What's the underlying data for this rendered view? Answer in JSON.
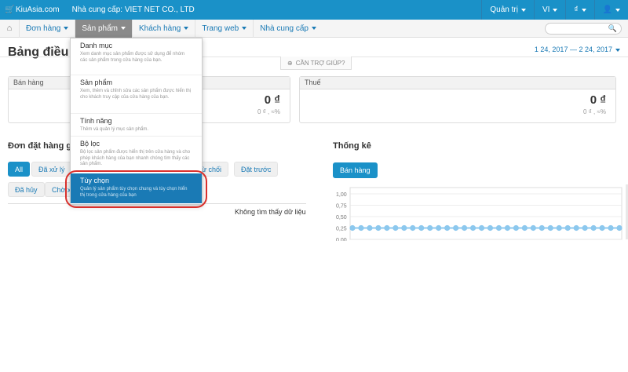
{
  "topbar": {
    "brand": "KiuAsia.com",
    "vendor": "Nhà cung cấp: VIET NET CO., LTD",
    "admin": "Quản trị",
    "lang": "VI",
    "currency": "₫"
  },
  "nav": {
    "items": [
      {
        "label": "Đơn hàng"
      },
      {
        "label": "Sản phẩm"
      },
      {
        "label": "Khách hàng"
      },
      {
        "label": "Trang web"
      },
      {
        "label": "Nhà cung cấp"
      }
    ]
  },
  "page": {
    "title": "Bảng điều k",
    "date_range": "1 24, 2017 — 2 24, 2017",
    "help": "CẦN TRỢ GIÚP?"
  },
  "panels": {
    "sales": {
      "label": "Bán hàng"
    },
    "sales_partial": {
      "amount": "0 ₫",
      "sub": "0 ₫ , ≈%"
    },
    "tax": {
      "label": "Thuế",
      "amount": "0 ₫",
      "sub": "0 ₫ , ≈%"
    }
  },
  "orders": {
    "title": "Đơn đặt hàng gầ",
    "filters": [
      "All",
      "Đã xử lý",
      "ừ chối",
      "Đặt trước",
      "Đã hủy",
      "Chờ x"
    ],
    "empty": "Không tìm thấy dữ liệu"
  },
  "stats": {
    "title": "Thống kê",
    "tab": "Bán hàng"
  },
  "chart_data": {
    "type": "line",
    "yticks": [
      "1,00",
      "0,75",
      "0,50",
      "0,25",
      "0,00"
    ],
    "ylim": [
      0,
      1
    ],
    "series": [
      {
        "values": [
          0.25,
          0.25,
          0.25,
          0.25,
          0.25,
          0.25,
          0.25,
          0.25,
          0.25,
          0.25,
          0.25,
          0.25,
          0.25,
          0.25,
          0.25,
          0.25,
          0.25,
          0.25,
          0.25,
          0.25,
          0.25,
          0.25,
          0.25,
          0.25,
          0.25,
          0.25,
          0.25,
          0.25,
          0.25,
          0.25,
          0.25,
          0.25
        ]
      }
    ],
    "color": "#8cc8ee"
  },
  "dropdown": {
    "items": [
      {
        "title": "Danh mục",
        "desc": "Xem danh mục sản phẩm được sử dụng để nhóm các sản phẩm trong cửa hàng của bạn."
      },
      {
        "title": "Sản phẩm",
        "desc": "Xem, thêm và chỉnh sửa các sản phẩm được hiển thị cho khách truy cập của cửa hàng của bạn."
      },
      {
        "title": "Tính năng",
        "desc": "Thêm và quản lý mục sản phẩm."
      },
      {
        "title": "Bộ lọc",
        "desc": "Bộ lọc sản phẩm được hiển thị trên cửa hàng và cho phép khách hàng của bạn nhanh chóng tìm thấy các sản phẩm."
      },
      {
        "title": "Tùy chọn",
        "desc": "Quản lý sản phẩm tùy chọn chung và tùy chọn hiển thị trong cửa hàng của bạn"
      }
    ]
  },
  "colors": {
    "accent": "#1a91c8",
    "highlight": "#1a7ab5",
    "annotation": "#d9302c"
  }
}
